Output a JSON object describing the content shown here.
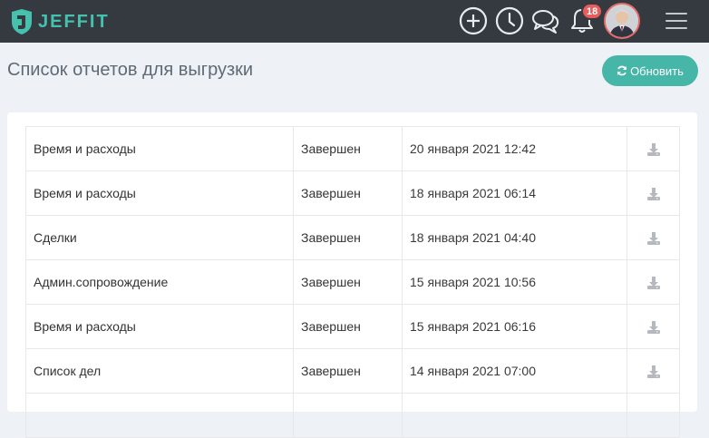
{
  "header": {
    "logo_text": "JEFFIT",
    "notifications_count": "18",
    "colors": {
      "bar": "#343a40",
      "brand": "#45c1ae",
      "badge": "#e85c5c"
    },
    "icons": [
      "add-circle-icon",
      "clock-icon",
      "chat-icon",
      "bell-icon",
      "avatar",
      "hamburger-menu-icon"
    ]
  },
  "page": {
    "title": "Список отчетов для выгрузки",
    "refresh_label": "Обновить"
  },
  "reports": [
    {
      "name": "Время и расходы",
      "status": "Завершен",
      "date": "20 января 2021 12:42"
    },
    {
      "name": "Время и расходы",
      "status": "Завершен",
      "date": "18 января 2021 06:14"
    },
    {
      "name": "Сделки",
      "status": "Завершен",
      "date": "18 января 2021 04:40"
    },
    {
      "name": "Админ.сопровождение",
      "status": "Завершен",
      "date": "15 января 2021 10:56"
    },
    {
      "name": "Время и расходы",
      "status": "Завершен",
      "date": "15 января 2021 06:16"
    },
    {
      "name": "Список дел",
      "status": "Завершен",
      "date": "14 января 2021 07:00"
    },
    {
      "name": "",
      "status": "",
      "date": ""
    }
  ]
}
